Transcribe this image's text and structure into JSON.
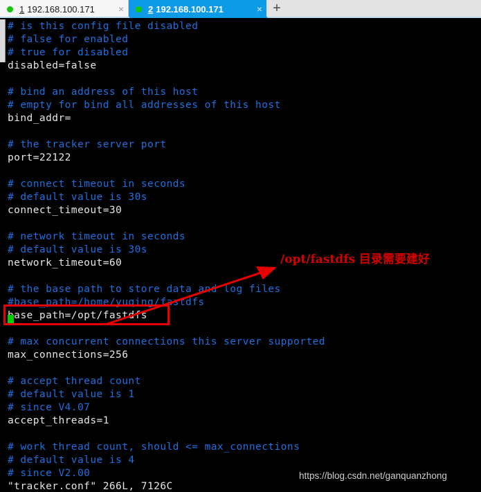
{
  "window": {
    "tabs": [
      {
        "number": "1",
        "title": "192.168.100.171",
        "status_dot": "green-dot-icon",
        "close": "×",
        "active": false
      },
      {
        "number": "2",
        "title": "192.168.100.171",
        "status_dot": "green-dot-icon",
        "close": "×",
        "active": true
      }
    ],
    "new_tab_label": "+"
  },
  "terminal": {
    "background": "#000000",
    "comment_color": "#1f6fe0",
    "text_color": "#e6e6e6",
    "lines": [
      {
        "text": "# is this config file disabled",
        "type": "comment"
      },
      {
        "text": "# false for enabled",
        "type": "comment"
      },
      {
        "text": "# true for disabled",
        "type": "comment"
      },
      {
        "text": "disabled=false",
        "type": "code"
      },
      {
        "text": "",
        "type": "blank"
      },
      {
        "text": "# bind an address of this host",
        "type": "comment"
      },
      {
        "text": "# empty for bind all addresses of this host",
        "type": "comment"
      },
      {
        "text": "bind_addr=",
        "type": "code"
      },
      {
        "text": "",
        "type": "blank"
      },
      {
        "text": "# the tracker server port",
        "type": "comment"
      },
      {
        "text": "port=22122",
        "type": "code"
      },
      {
        "text": "",
        "type": "blank"
      },
      {
        "text": "# connect timeout in seconds",
        "type": "comment"
      },
      {
        "text": "# default value is 30s",
        "type": "comment"
      },
      {
        "text": "connect_timeout=30",
        "type": "code"
      },
      {
        "text": "",
        "type": "blank"
      },
      {
        "text": "# network timeout in seconds",
        "type": "comment"
      },
      {
        "text": "# default value is 30s",
        "type": "comment"
      },
      {
        "text": "network_timeout=60",
        "type": "code"
      },
      {
        "text": "",
        "type": "blank"
      },
      {
        "text": "# the base path to store data and log files",
        "type": "comment"
      },
      {
        "text": "#base_path=/home/yuqing/fastdfs",
        "type": "comment"
      },
      {
        "text": "base_path=/opt/fastdfs",
        "type": "code"
      },
      {
        "text": "",
        "type": "blank"
      },
      {
        "text": "# max concurrent connections this server supported",
        "type": "comment"
      },
      {
        "text": "max_connections=256",
        "type": "code"
      },
      {
        "text": "",
        "type": "blank"
      },
      {
        "text": "# accept thread count",
        "type": "comment"
      },
      {
        "text": "# default value is 1",
        "type": "comment"
      },
      {
        "text": "# since V4.07",
        "type": "comment"
      },
      {
        "text": "accept_threads=1",
        "type": "code"
      },
      {
        "text": "",
        "type": "blank"
      },
      {
        "text": "# work thread count, should <= max_connections",
        "type": "comment"
      },
      {
        "text": "# default value is 4",
        "type": "comment"
      },
      {
        "text": "# since V2.00",
        "type": "comment"
      },
      {
        "text": "\"tracker.conf\" 266L, 7126C",
        "type": "code"
      }
    ]
  },
  "annotations": {
    "note_text": "/opt/fastdfs 目录需要建好",
    "note_color": "#d40000",
    "highlight_color": "#e60000",
    "arrow_color": "#e60000"
  },
  "watermark": {
    "text": "https://blog.csdn.net/ganquanzhong",
    "color": "#cfcfcf"
  }
}
